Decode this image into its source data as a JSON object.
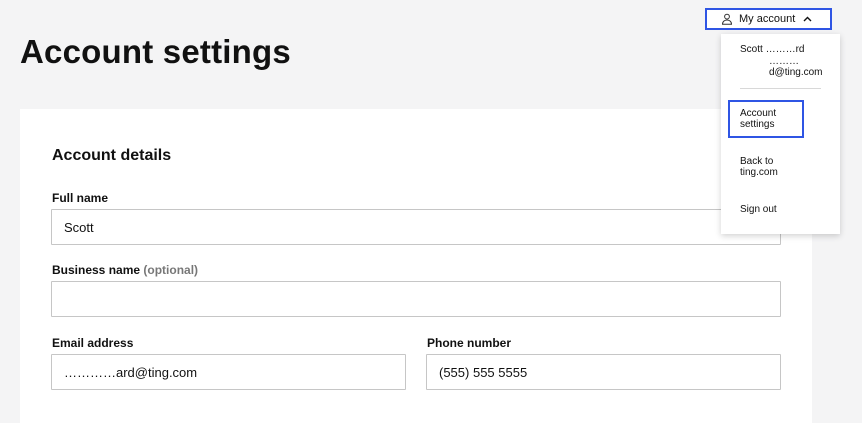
{
  "page": {
    "title": "Account settings"
  },
  "header": {
    "account_button_label": "My account",
    "icons": {
      "user": "user-icon",
      "chevron": "chevron-up-icon"
    },
    "accent_color": "#2f55e4"
  },
  "account_menu": {
    "name": "Scott ………rd",
    "email": "………d@ting.com",
    "items": [
      {
        "label": "Account settings",
        "active": true
      },
      {
        "label": "Back to ting.com",
        "active": false
      },
      {
        "label": "Sign out",
        "active": false
      }
    ]
  },
  "account_details": {
    "title": "Account details",
    "full_name": {
      "label": "Full name",
      "value": "Scott"
    },
    "business_name": {
      "label": "Business name",
      "optional": "(optional)",
      "value": ""
    },
    "email": {
      "label": "Email address",
      "value": "…………ard@ting.com"
    },
    "phone": {
      "label": "Phone number",
      "value": "(555) 555 5555"
    }
  }
}
